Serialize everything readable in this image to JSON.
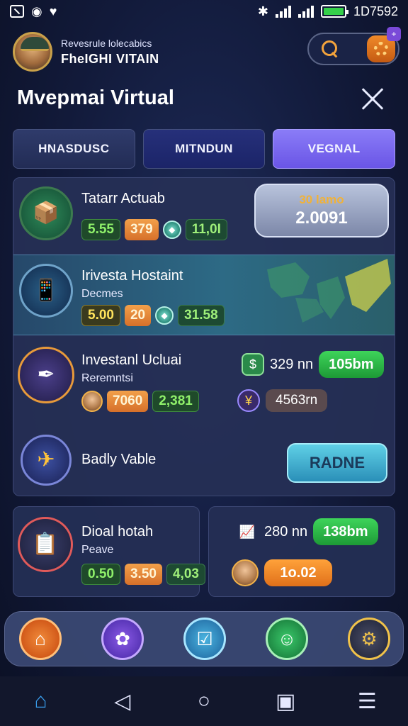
{
  "status_bar": {
    "time": "1D7592",
    "left_icons": [
      "screenshot-icon",
      "alarm-icon",
      "heart-icon"
    ],
    "right_icons": [
      "bluetooth-icon",
      "signal-icon",
      "signal-icon",
      "battery-icon"
    ],
    "battery_color": "#35d04a"
  },
  "header": {
    "user_subtitle": "Revesrule lolecabics",
    "user_name": "FheIGHI VITAIN",
    "notification_badge": "+",
    "accent": "#f08a2a"
  },
  "page": {
    "title": "Mvepmai Virtual"
  },
  "tabs": [
    {
      "label": "HNASDUSC",
      "active": false
    },
    {
      "label": "MITNDUN",
      "active": false
    },
    {
      "label": "VEGNAL",
      "active": true
    }
  ],
  "rows": [
    {
      "title": "Tatarr Actuab",
      "chips": [
        "5.55",
        "379",
        "11,0I"
      ],
      "value_card": {
        "top": "30 lamo",
        "main": "2.0091"
      }
    },
    {
      "title": "Irivesta Hostaint",
      "subtitle": "Decmes",
      "chips": [
        "5.00",
        "20",
        "31.58"
      ]
    },
    {
      "title": "Investanl Ucluai",
      "subtitle": "Reremntsi",
      "chips": [
        "7060",
        "2,381"
      ],
      "metric_top": {
        "text": "329 nn",
        "pill": "105bm"
      },
      "metric_bottom": {
        "pill": "4563rn"
      }
    },
    {
      "title": "Badly Vable",
      "button": "RADNE"
    }
  ],
  "cards": {
    "left": {
      "title": "Dioal hotah",
      "subtitle": "Peave",
      "chips": [
        "0.50",
        "3.50",
        "4,03"
      ]
    },
    "right": {
      "metric_text": "280 nn",
      "pill_green": "138bm",
      "pill_orange": "1o.02"
    }
  },
  "dock": [
    "home-icon",
    "settings-icon",
    "tasks-icon",
    "chat-icon",
    "gear-icon"
  ],
  "system_nav": [
    "home-icon",
    "back-icon",
    "circle-home-icon",
    "recents-icon",
    "menu-icon"
  ]
}
